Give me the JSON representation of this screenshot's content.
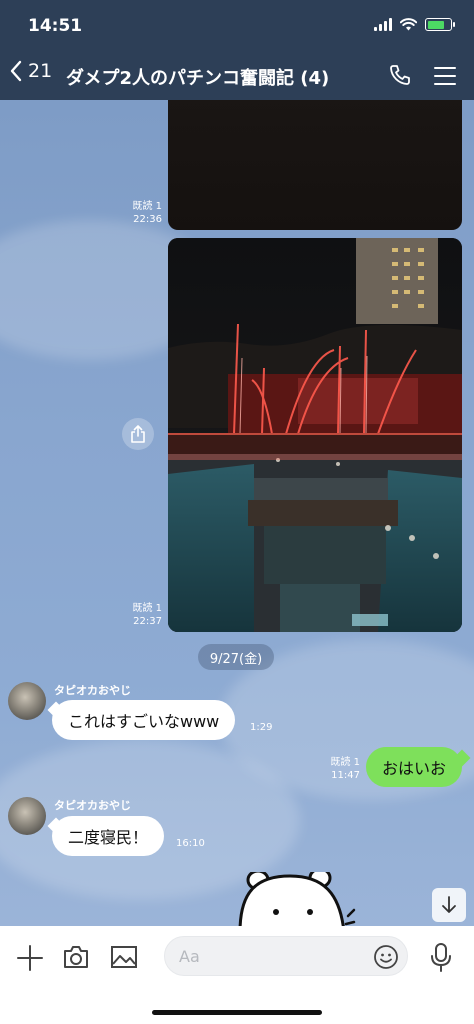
{
  "status": {
    "time": "14:51",
    "battery_level": 0.75
  },
  "header": {
    "back_count": "21",
    "title": "ダメプ2人のパチンコ奮闘記 (4)"
  },
  "messages": [
    {
      "read": "既読 1",
      "time": "22:36"
    },
    {
      "read": "既読 1",
      "time": "22:37"
    }
  ],
  "date_separator": "9/27(金)",
  "incoming_1": {
    "sender": "タピオカおやじ",
    "text": "これはすごいなwww",
    "time": "1:29"
  },
  "outgoing_1": {
    "read": "既読 1",
    "time": "11:47",
    "text": "おはいお"
  },
  "incoming_2": {
    "sender": "タピオカおやじ",
    "text": "二度寝民！",
    "time": "16:10"
  },
  "input": {
    "placeholder": "Aa"
  },
  "icons": {
    "back": "chevron-left-icon",
    "call": "phone-icon",
    "menu": "hamburger-menu-icon",
    "share": "share-icon",
    "scroll_down": "arrow-down-icon",
    "add": "plus-icon",
    "camera": "camera-icon",
    "image": "image-icon",
    "emoji": "smiley-icon",
    "mic": "microphone-icon"
  },
  "colors": {
    "header": "#2d3f57",
    "outgoing_bubble": "#7ee05b",
    "incoming_bubble": "#ffffff"
  }
}
